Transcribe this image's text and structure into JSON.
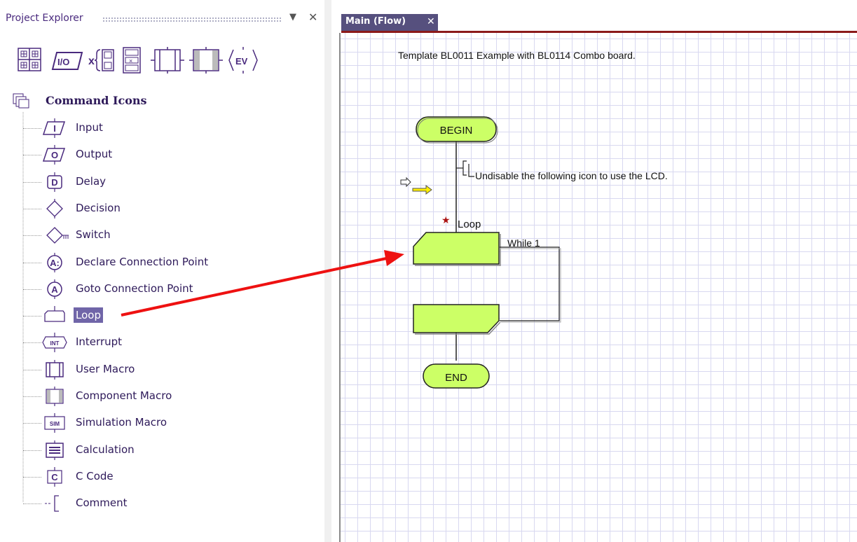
{
  "panel": {
    "title": "Project Explorer",
    "dropdown_icon": "dropdown-triangle-icon",
    "close_label": "✕"
  },
  "toolbar": {
    "icons": [
      "grid-icon",
      "io-icon",
      "variables-icon",
      "macro-list-icon",
      "user-macro-icon",
      "component-macro-icon",
      "events-icon"
    ],
    "io_label": "I/O",
    "events_label": "EV"
  },
  "tree": {
    "root_label": "Command Icons",
    "items": [
      {
        "label": "Input",
        "icon": "input-icon",
        "glyph": "I"
      },
      {
        "label": "Output",
        "icon": "output-icon",
        "glyph": "O"
      },
      {
        "label": "Delay",
        "icon": "delay-icon",
        "glyph": "D"
      },
      {
        "label": "Decision",
        "icon": "decision-icon",
        "glyph": ""
      },
      {
        "label": "Switch",
        "icon": "switch-icon",
        "glyph": ""
      },
      {
        "label": "Declare Connection Point",
        "icon": "declare-connection-icon",
        "glyph": "A:"
      },
      {
        "label": "Goto Connection Point",
        "icon": "goto-connection-icon",
        "glyph": "A"
      },
      {
        "label": "Loop",
        "icon": "loop-icon",
        "glyph": "",
        "selected": true
      },
      {
        "label": "Interrupt",
        "icon": "interrupt-icon",
        "glyph": "INT"
      },
      {
        "label": "User Macro",
        "icon": "user-macro-icon",
        "glyph": ""
      },
      {
        "label": "Component Macro",
        "icon": "component-macro-icon",
        "glyph": ""
      },
      {
        "label": "Simulation Macro",
        "icon": "simulation-macro-icon",
        "glyph": "SIM"
      },
      {
        "label": "Calculation",
        "icon": "calculation-icon",
        "glyph": ""
      },
      {
        "label": "C Code",
        "icon": "c-code-icon",
        "glyph": "C"
      },
      {
        "label": "Comment",
        "icon": "comment-icon",
        "glyph": ""
      }
    ]
  },
  "tab": {
    "label": "Main (Flow)",
    "close_label": "✕"
  },
  "flowchart": {
    "heading": "Template BL0011 Example with BL0114 Combo board.",
    "begin_label": "BEGIN",
    "end_label": "END",
    "comment_text": "Undisable the following icon to use the LCD.",
    "loop_label": "Loop",
    "loop_condition": "While 1"
  },
  "colors": {
    "terminal_fill": "#ccff66",
    "tab_bg": "#56507e",
    "tab_underline": "#8b1a1a",
    "selection": "#7065a8",
    "arrow": "#ee1111",
    "label_text": "#2e1a5a"
  }
}
